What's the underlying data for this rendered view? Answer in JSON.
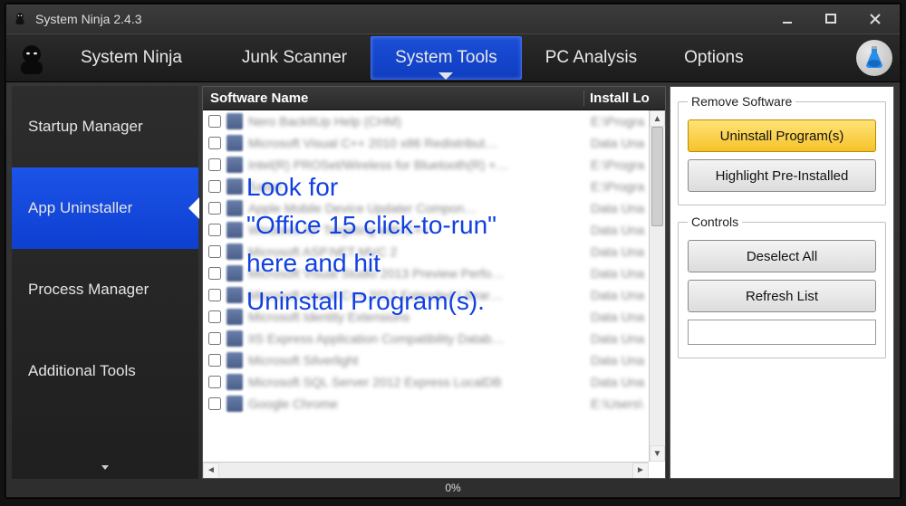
{
  "title": "System Ninja 2.4.3",
  "nav": {
    "brand": "System Ninja",
    "items": [
      "Junk Scanner",
      "System Tools",
      "PC Analysis",
      "Options"
    ],
    "active_index": 1
  },
  "sidebar": {
    "items": [
      "Startup Manager",
      "App Uninstaller",
      "Process Manager",
      "Additional Tools"
    ],
    "active_index": 1
  },
  "list": {
    "columns": {
      "name": "Software Name",
      "location": "Install Lo"
    },
    "rows": [
      {
        "name": "Nero BackItUp Help (CHM)",
        "loc": "E:\\Progra"
      },
      {
        "name": "Microsoft Visual C++ 2010  x86 Redistribut…",
        "loc": "Data Una"
      },
      {
        "name": "Intel(R) PROSet/Wireless for Bluetooth(R) +…",
        "loc": "E:\\Progra"
      },
      {
        "name": "Safari",
        "loc": "E:\\Progra"
      },
      {
        "name": "Apple Mobile Device Updater Compon…",
        "loc": "Data Una"
      },
      {
        "name": "Windows XP Targeting with C++",
        "loc": "Data Una"
      },
      {
        "name": "Microsoft ASP.NET MVC 2",
        "loc": "Data Una"
      },
      {
        "name": "Microsoft Visual Studio 2013 Preview Perfo…",
        "loc": "Data Una"
      },
      {
        "name": "Microsoft Visual C++ 2012 Extended Librar…",
        "loc": "Data Una"
      },
      {
        "name": "Microsoft Identity Extensions",
        "loc": "Data Una"
      },
      {
        "name": "IIS Express Application Compatibility Datab…",
        "loc": "Data Una"
      },
      {
        "name": "Microsoft Silverlight",
        "loc": "Data Una"
      },
      {
        "name": "Microsoft SQL Server 2012 Express LocalDB",
        "loc": "Data Una"
      },
      {
        "name": "Google Chrome",
        "loc": "E:\\Users\\"
      }
    ]
  },
  "right": {
    "remove_legend": "Remove Software",
    "uninstall": "Uninstall Program(s)",
    "highlight": "Highlight Pre-Installed",
    "controls_legend": "Controls",
    "deselect": "Deselect All",
    "refresh": "Refresh List",
    "filter_value": ""
  },
  "status": {
    "progress": "0%"
  },
  "annotation": "Look for\n\"Office 15 click-to-run\"\nhere and hit\nUninstall Program(s)."
}
